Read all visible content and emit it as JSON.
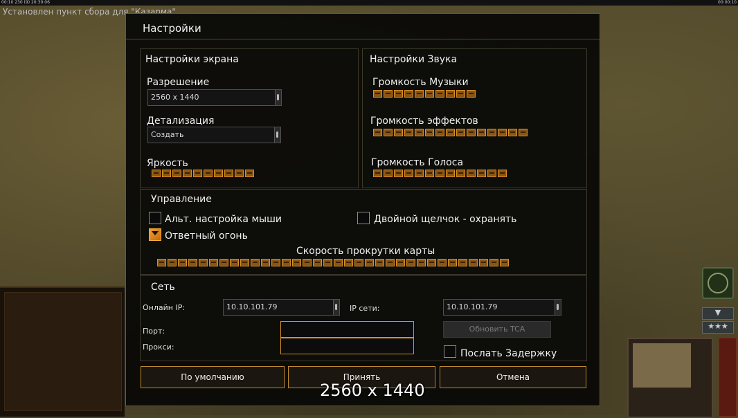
{
  "hud": {
    "top_left": "00:10 230 (9) 20:30:06",
    "top_right": "00:00:10",
    "notice": "Установлен пункт сбора для \"Казарма\""
  },
  "dialog": {
    "title": "Настройки",
    "screen": {
      "header": "Настройки экрана",
      "resolution_label": "Разрешение",
      "resolution_value": "2560 x 1440",
      "detail_label": "Детализация",
      "detail_value": "Создать",
      "brightness_label": "Яркость",
      "brightness_level": 10
    },
    "sound": {
      "header": "Настройки Звука",
      "music_label": "Громкость Музыки",
      "music_level": 10,
      "effects_label": "Громкость эффектов",
      "effects_level": 15,
      "voice_label": "Громкость Голоса",
      "voice_level": 13
    },
    "controls": {
      "header": "Управление",
      "alt_mouse_label": "Альт. настройка мыши",
      "alt_mouse_checked": false,
      "double_click_label": "Двойной щелчок - охранять",
      "double_click_checked": false,
      "return_fire_label": "Ответный огонь",
      "return_fire_checked": true,
      "scroll_speed_label": "Скорость прокрутки карты",
      "scroll_level": 34
    },
    "network": {
      "header": "Сеть",
      "online_ip_label": "Онлайн IP:",
      "online_ip_value": "10.10.101.79",
      "lan_ip_label": "IP сети:",
      "lan_ip_value": "10.10.101.79",
      "port_label": "Порт:",
      "port_value": "",
      "proxy_label": "Прокси:",
      "proxy_value": "",
      "update_button": "Обновить TCA",
      "send_delay_label": "Послать Задержку",
      "send_delay_checked": false
    },
    "buttons": {
      "default": "По умолчанию",
      "accept": "Принять",
      "cancel": "Отмена"
    }
  },
  "overlay_text": "2560 x 1440",
  "colors": {
    "accent_orange": "#d88d25",
    "dialog_border": "#6a5a2a",
    "button_border": "#c08a2e"
  }
}
